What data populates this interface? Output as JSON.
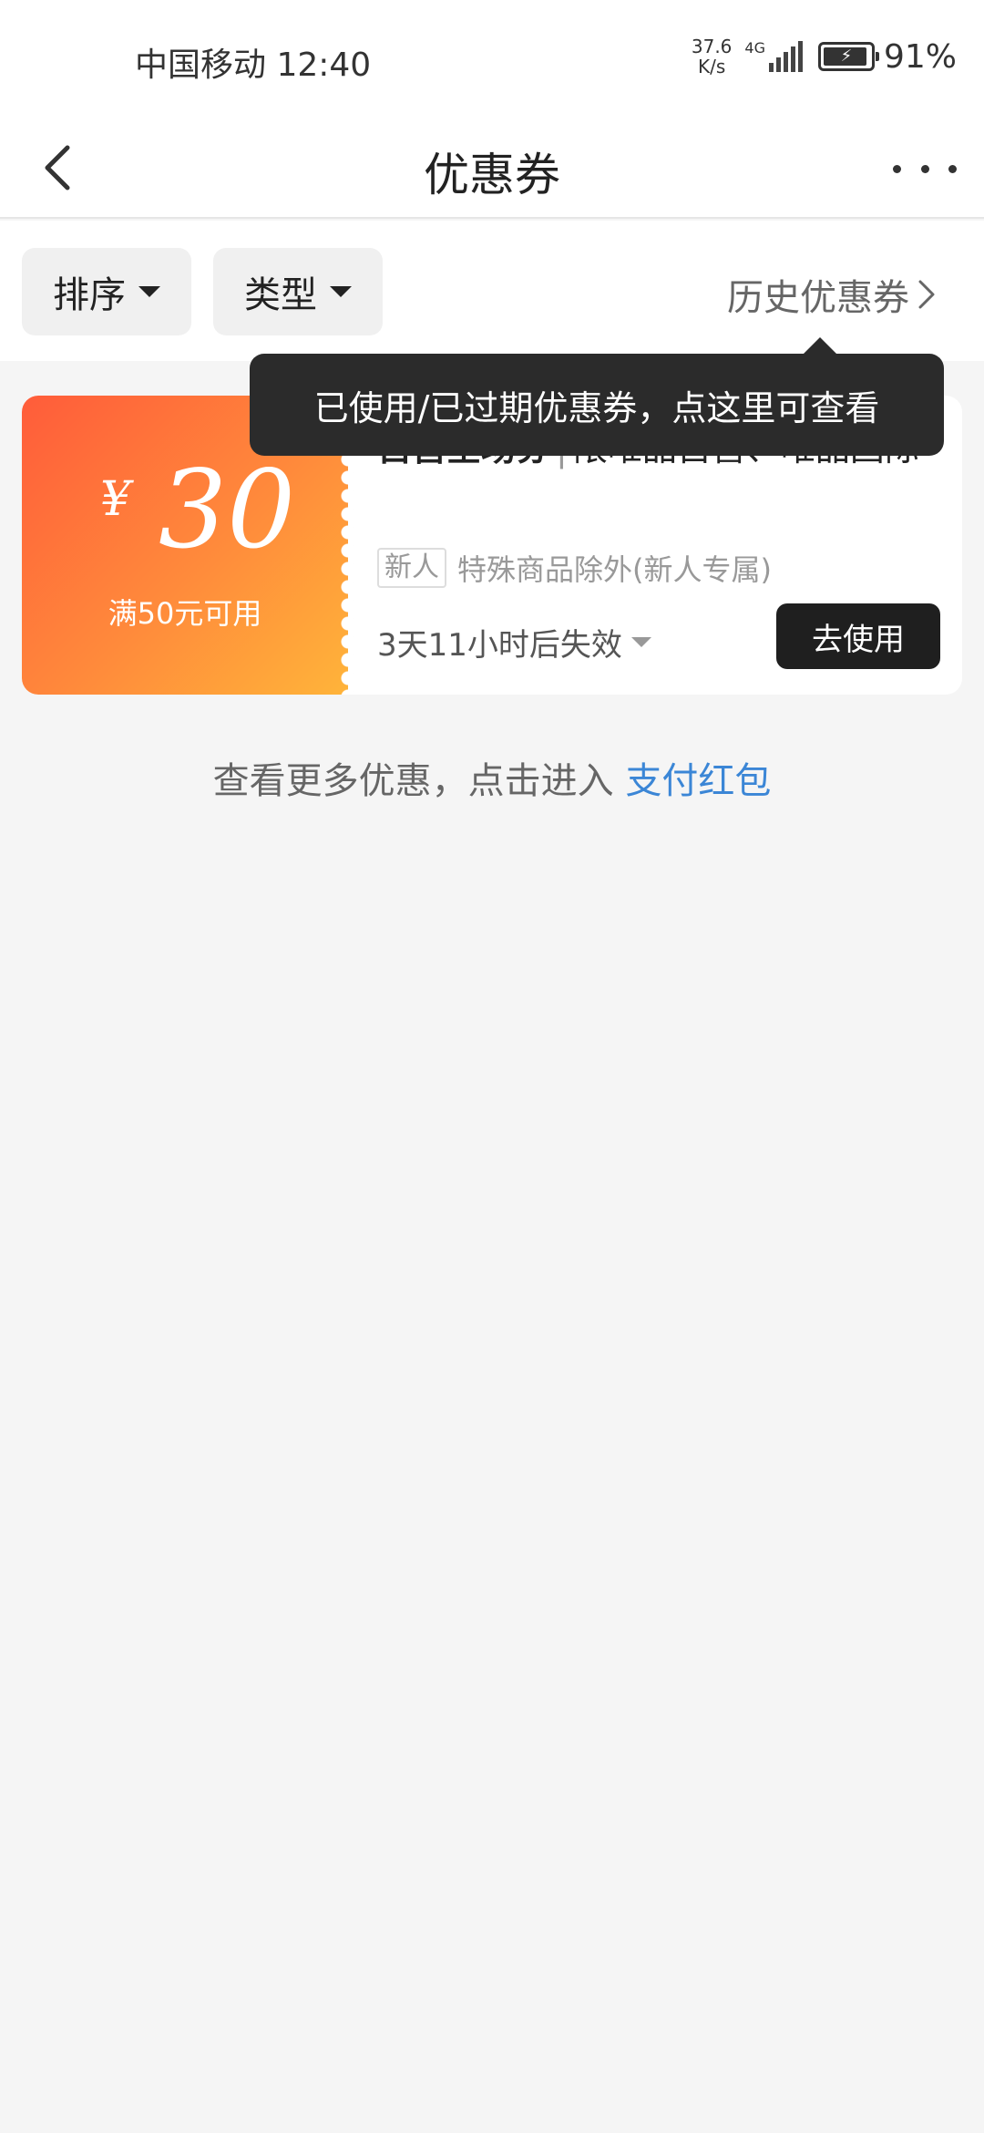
{
  "status_bar": {
    "carrier_time": "中国移动 12:40",
    "net_speed_value": "37.6",
    "net_speed_unit": "K/s",
    "network": "4G",
    "battery": "91%"
  },
  "nav": {
    "title": "优惠券"
  },
  "filters": {
    "sort_label": "排序",
    "type_label": "类型",
    "history_label": "历史优惠券"
  },
  "tooltip": {
    "text": "已使用/已过期优惠券，点这里可查看"
  },
  "coupon": {
    "currency": "¥",
    "amount": "30",
    "threshold": "满50元可用",
    "title_bold": "自营全场券",
    "separator": "|",
    "title_rest": "限唯品自营、唯品国际",
    "tag": "新人",
    "tag_desc": "特殊商品除外(新人专属)",
    "expire": "3天11小时后失效",
    "button_label": "去使用"
  },
  "footer": {
    "text": "查看更多优惠，点击进入 ",
    "link": "支付红包"
  },
  "colors": {
    "link": "#3b86d6",
    "coupon_gradient_start": "#ff5c3a",
    "coupon_gradient_end": "#ffb43a",
    "button_bg": "#1f1f1f"
  }
}
